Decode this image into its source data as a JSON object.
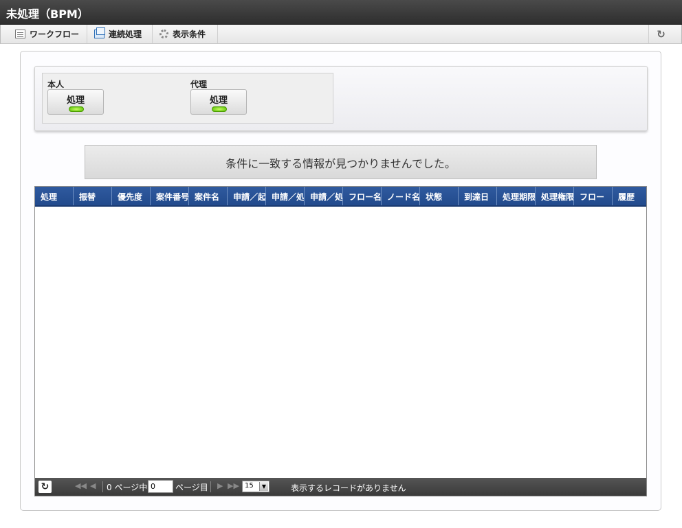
{
  "window": {
    "title": "未処理（BPM）"
  },
  "toolbar": {
    "workflow_label": "ワークフロー",
    "continuous_label": "連続処理",
    "display_condition_label": "表示条件",
    "refresh_symbol": "↻"
  },
  "filter": {
    "self": {
      "label": "本人",
      "button": "処理"
    },
    "proxy": {
      "label": "代理",
      "button": "処理"
    }
  },
  "message": "条件に一致する情報が見つかりませんでした。",
  "grid": {
    "columns": [
      "処理",
      "振替",
      "優先度",
      "案件番号",
      "案件名",
      "申請／起",
      "申請／処",
      "申請／処",
      "フロー名",
      "ノード名",
      "状態",
      "到達日",
      "処理期限",
      "処理権限",
      "フロー",
      "履歴"
    ],
    "rows": []
  },
  "pager": {
    "refresh_symbol": "↻",
    "first": "◀◀",
    "prev": "◀",
    "next": "▶",
    "last": "▶▶",
    "page_prefix": "0 ページ中",
    "page_value": "0",
    "page_suffix": "ページ目",
    "page_size": "15",
    "no_records": "表示するレコードがありません"
  }
}
